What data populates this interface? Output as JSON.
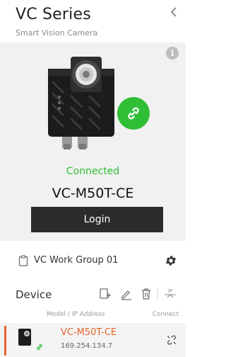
{
  "header": {
    "title": "VC Series",
    "subtitle": "Smart Vision Camera",
    "back_icon": "chevron-left-icon"
  },
  "camera_panel": {
    "info_icon": "info-icon",
    "info_label": "i",
    "status": "Connected",
    "status_color": "#2ebf36",
    "model": "VC-M50T-CE",
    "login_label": "Login"
  },
  "group": {
    "name": "VC Work Group 01",
    "icon": "clipboard-icon",
    "settings_icon": "gear-icon"
  },
  "device_list": {
    "title": "Device",
    "tools": [
      "add-device-icon",
      "edit-icon",
      "delete-icon",
      "ip-config-icon"
    ],
    "ip_tool_label": "IP",
    "columns": {
      "model": "Model / IP Address",
      "connect": "Connect"
    },
    "items": [
      {
        "name": "VC-M50T-CE",
        "ip": "169.254.134.7",
        "accent": "#e8622b",
        "connected": true
      }
    ]
  }
}
